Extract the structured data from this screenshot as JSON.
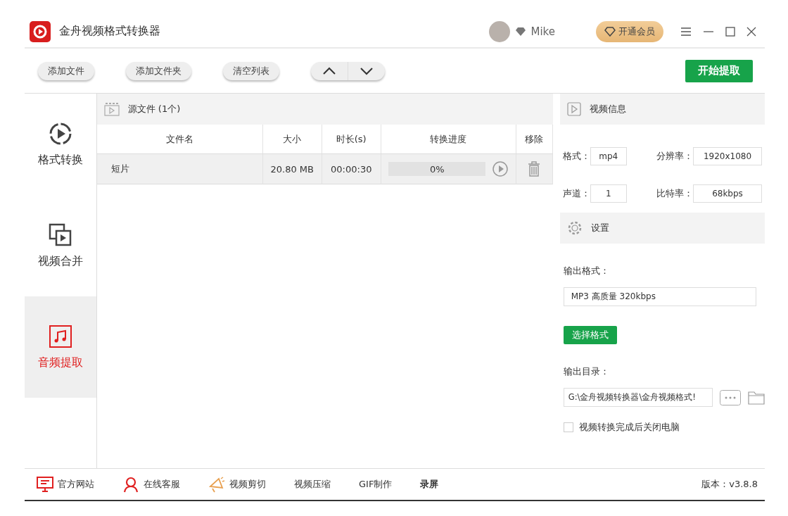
{
  "window": {
    "title": "金舟视频格式转换器",
    "user": "Mike",
    "vip_button": "开通会员"
  },
  "toolbar": {
    "buttons": [
      "添加文件",
      "添加文件夹",
      "清空列表"
    ],
    "start_button": "开始提取"
  },
  "sidebar": {
    "items": [
      {
        "label": "格式转换",
        "selected": false
      },
      {
        "label": "视频合并",
        "selected": false
      },
      {
        "label": "音频提取",
        "selected": true
      }
    ]
  },
  "source": {
    "title": "源文件 (1个)",
    "columns": [
      "文件名",
      "大小",
      "时长(s)",
      "转换进度",
      "移除"
    ],
    "rows": [
      {
        "name": "短片",
        "size": "20.80 MB",
        "duration": "00:00:30",
        "progress_text": "0%",
        "level": 0
      }
    ]
  },
  "video_info": {
    "title": "视频信息",
    "fields": [
      {
        "label": "格式：",
        "value": "mp4"
      },
      {
        "label": "分辨率：",
        "value": "1920x1080"
      },
      {
        "label": "声道：",
        "value": "1"
      },
      {
        "label": "比特率：",
        "value": "68kbps"
      }
    ]
  },
  "settings": {
    "title": "设置",
    "format_label": "输出格式：",
    "format_value": "MP3 高质量 320kbps",
    "choose_button": "选择格式",
    "dir_label": "输出目录：",
    "dir_value": "G:\\金舟视频转换器\\金舟视频格式!",
    "shutdown": {
      "label": "视频转换完成后关闭电脑",
      "checked": false
    }
  },
  "footer": {
    "links": [
      {
        "label": "官方网站",
        "bold": false
      },
      {
        "label": "在线客服",
        "bold": false
      },
      {
        "label": "视频剪切",
        "bold": false
      },
      {
        "label": "视频压缩",
        "bold": false
      },
      {
        "label": "GIF制作",
        "bold": false
      },
      {
        "label": "录屏",
        "bold": true
      }
    ],
    "version": "版本：v3.8.8"
  }
}
